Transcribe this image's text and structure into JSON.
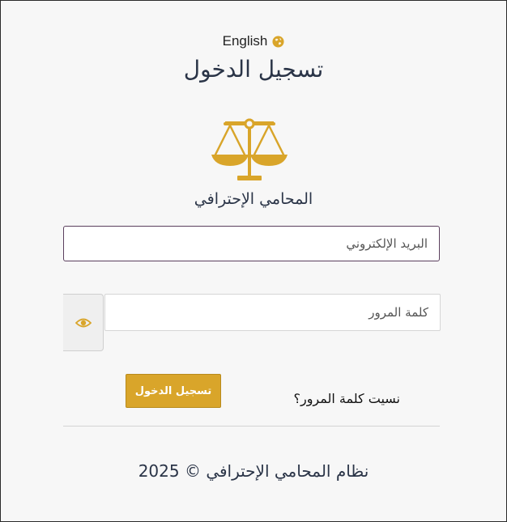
{
  "language_toggle": {
    "label": "English",
    "icon": "globe-icon"
  },
  "header": {
    "title": "تسجيل الدخول"
  },
  "logo": {
    "icon": "scales-of-justice-icon",
    "color": "#d9a52a"
  },
  "brand": {
    "name": "المحامي الإحترافي"
  },
  "login_form": {
    "email": {
      "placeholder": "البريد الإلكتروني",
      "value": ""
    },
    "password": {
      "placeholder": "كلمة المرور",
      "value": ""
    },
    "toggle_visibility_icon": "eye-icon",
    "submit_label": "تسجيل الدخول",
    "forgot_password_label": "نسيت كلمة المرور؟"
  },
  "footer": {
    "copyright": "نظام المحامي الإحترافي © 2025"
  },
  "colors": {
    "accent": "#d9a52a",
    "text": "#2a3447",
    "email_border": "#5b3f5e",
    "background": "#f7f7f7"
  }
}
